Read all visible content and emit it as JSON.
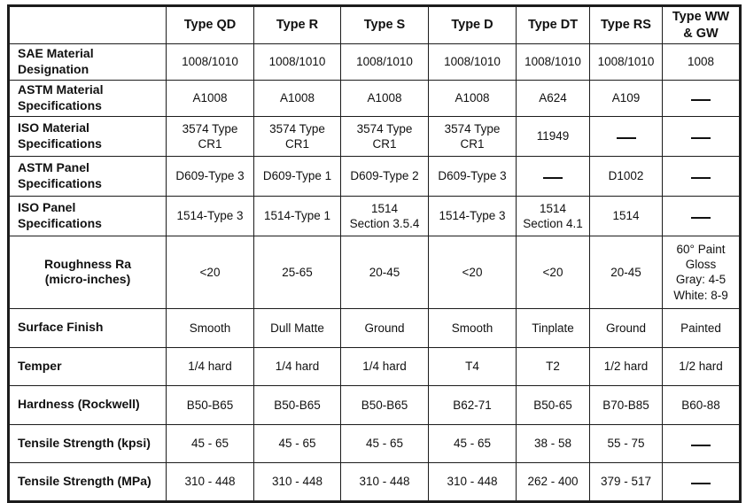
{
  "table": {
    "corner_label": "",
    "columns": [
      {
        "id": "qd",
        "label": "Type QD"
      },
      {
        "id": "r",
        "label": "Type R"
      },
      {
        "id": "s",
        "label": "Type S"
      },
      {
        "id": "d",
        "label": "Type D"
      },
      {
        "id": "dt",
        "label": "Type DT"
      },
      {
        "id": "rs",
        "label": "Type RS"
      },
      {
        "id": "ww",
        "label": "Type WW\n& GW"
      }
    ],
    "rows": [
      {
        "label": "SAE Material Designation",
        "cells": [
          "1008/1010",
          "1008/1010",
          "1008/1010",
          "1008/1010",
          "1008/1010",
          "1008/1010",
          "1008"
        ]
      },
      {
        "label": "ASTM Material\nSpecifications",
        "cells": [
          "A1008",
          "A1008",
          "A1008",
          "A1008",
          "A624",
          "A109",
          "—"
        ]
      },
      {
        "label": "ISO Material\nSpecifications",
        "cells": [
          "3574 Type\nCR1",
          "3574 Type\nCR1",
          "3574 Type\nCR1",
          "3574 Type\nCR1",
          "11949",
          "—",
          "—"
        ]
      },
      {
        "label": "ASTM Panel\nSpecifications",
        "cells": [
          "D609-Type 3",
          "D609-Type 1",
          "D609-Type 2",
          "D609-Type 3",
          "—",
          "D1002",
          "—"
        ]
      },
      {
        "label": "ISO Panel\nSpecifications",
        "cells": [
          "1514-Type 3",
          "1514-Type 1",
          "1514\nSection 3.5.4",
          "1514-Type 3",
          "1514\nSection 4.1",
          "1514",
          "—"
        ]
      },
      {
        "label": "Roughness Ra\n(micro-inches)",
        "label_centered": true,
        "cells": [
          "<20",
          "25-65",
          "20-45",
          "<20",
          "<20",
          "20-45",
          "60° Paint\nGloss\nGray: 4-5\nWhite: 8-9"
        ]
      },
      {
        "label": "Surface Finish",
        "cells": [
          "Smooth",
          "Dull Matte",
          "Ground",
          "Smooth",
          "Tinplate",
          "Ground",
          "Painted"
        ]
      },
      {
        "label": "Temper",
        "cells": [
          "1/4 hard",
          "1/4 hard",
          "1/4 hard",
          "T4",
          "T2",
          "1/2 hard",
          "1/2 hard"
        ]
      },
      {
        "label": "Hardness (Rockwell)",
        "cells": [
          "B50-B65",
          "B50-B65",
          "B50-B65",
          "B62-71",
          "B50-65",
          "B70-B85",
          "B60-88"
        ]
      },
      {
        "label": "Tensile Strength (kpsi)",
        "cells": [
          "45 - 65",
          "45 - 65",
          "45 - 65",
          "45 - 65",
          "38 - 58",
          "55 - 75",
          "—"
        ]
      },
      {
        "label": "Tensile Strength (MPa)",
        "cells": [
          "310 - 448",
          "310 - 448",
          "310 - 448",
          "310 - 448",
          "262 - 400",
          "379 - 517",
          "—"
        ]
      }
    ]
  },
  "colors": {
    "border": "#1c1c1c",
    "text": "#111111",
    "background": "#ffffff"
  }
}
